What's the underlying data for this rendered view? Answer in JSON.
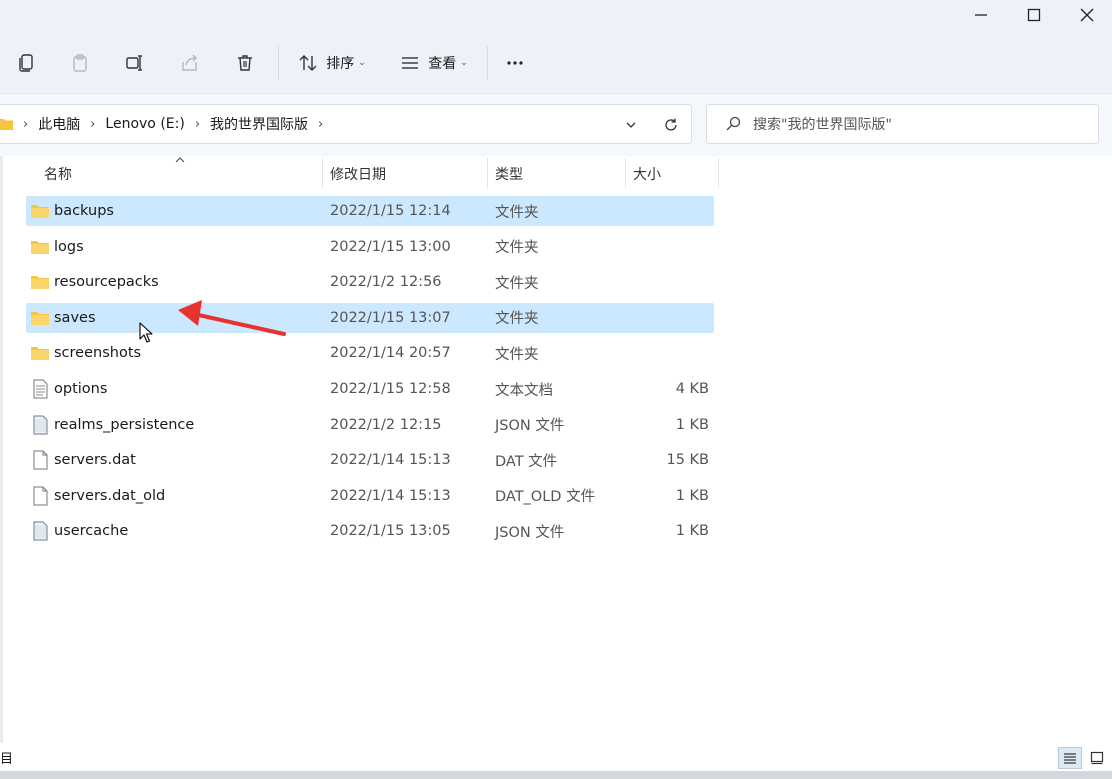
{
  "window": {
    "minimize_icon": "minimize-icon",
    "maximize_icon": "maximize-icon",
    "close_icon": "close-icon"
  },
  "toolbar": {
    "sort_label": "排序",
    "view_label": "查看",
    "more_label": "···"
  },
  "address": {
    "crumbs": [
      "此电脑",
      "Lenovo (E:)",
      "我的世界国际版"
    ]
  },
  "search": {
    "placeholder": "搜索\"我的世界国际版\""
  },
  "columns": {
    "name": "名称",
    "date": "修改日期",
    "type": "类型",
    "size": "大小"
  },
  "files": [
    {
      "name": "backups",
      "date": "2022/1/15 12:14",
      "type": "文件夹",
      "size": "",
      "icon": "folder-icon",
      "selected": true
    },
    {
      "name": "logs",
      "date": "2022/1/15 13:00",
      "type": "文件夹",
      "size": "",
      "icon": "folder-icon",
      "selected": false
    },
    {
      "name": "resourcepacks",
      "date": "2022/1/2 12:56",
      "type": "文件夹",
      "size": "",
      "icon": "folder-icon",
      "selected": false
    },
    {
      "name": "saves",
      "date": "2022/1/15 13:07",
      "type": "文件夹",
      "size": "",
      "icon": "folder-icon",
      "selected": true
    },
    {
      "name": "screenshots",
      "date": "2022/1/14 20:57",
      "type": "文件夹",
      "size": "",
      "icon": "folder-icon",
      "selected": false
    },
    {
      "name": "options",
      "date": "2022/1/15 12:58",
      "type": "文本文档",
      "size": "4 KB",
      "icon": "text-file-icon",
      "selected": false
    },
    {
      "name": "realms_persistence",
      "date": "2022/1/2 12:15",
      "type": "JSON 文件",
      "size": "1 KB",
      "icon": "json-file-icon",
      "selected": false
    },
    {
      "name": "servers.dat",
      "date": "2022/1/14 15:13",
      "type": "DAT 文件",
      "size": "15 KB",
      "icon": "file-icon",
      "selected": false
    },
    {
      "name": "servers.dat_old",
      "date": "2022/1/14 15:13",
      "type": "DAT_OLD 文件",
      "size": "1 KB",
      "icon": "file-icon",
      "selected": false
    },
    {
      "name": "usercache",
      "date": "2022/1/15 13:05",
      "type": "JSON 文件",
      "size": "1 KB",
      "icon": "json-file-icon",
      "selected": false
    }
  ],
  "statusbar": {
    "left_text": "目"
  },
  "colors": {
    "selection": "#cce8ff",
    "folder": "#f5c542",
    "arrow": "#e8322d"
  }
}
